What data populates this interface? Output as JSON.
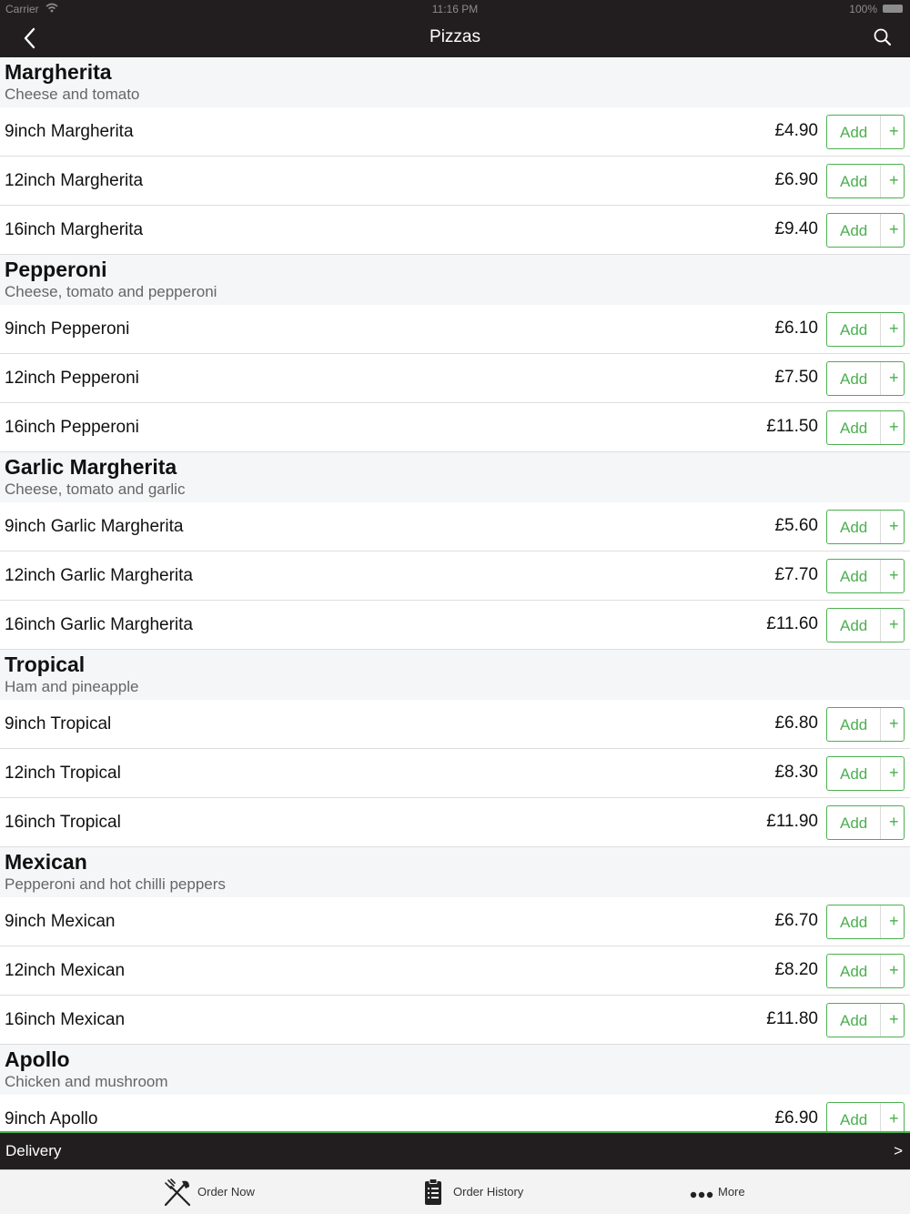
{
  "status_bar": {
    "carrier": "Carrier",
    "time": "11:16 PM",
    "battery": "100%"
  },
  "nav": {
    "title": "Pizzas"
  },
  "sections": [
    {
      "title": "Margherita",
      "description": "Cheese and tomato",
      "items": [
        {
          "name": "9inch Margherita",
          "price": "£4.90"
        },
        {
          "name": "12inch Margherita",
          "price": "£6.90"
        },
        {
          "name": "16inch Margherita",
          "price": "£9.40"
        }
      ]
    },
    {
      "title": "Pepperoni",
      "description": "Cheese, tomato and pepperoni",
      "items": [
        {
          "name": "9inch Pepperoni",
          "price": "£6.10"
        },
        {
          "name": "12inch Pepperoni",
          "price": "£7.50"
        },
        {
          "name": "16inch Pepperoni",
          "price": "£11.50"
        }
      ]
    },
    {
      "title": "Garlic Margherita",
      "description": "Cheese, tomato and garlic",
      "items": [
        {
          "name": "9inch Garlic Margherita",
          "price": "£5.60"
        },
        {
          "name": "12inch Garlic Margherita",
          "price": "£7.70"
        },
        {
          "name": "16inch Garlic Margherita",
          "price": "£11.60"
        }
      ]
    },
    {
      "title": "Tropical",
      "description": "Ham and pineapple",
      "items": [
        {
          "name": "9inch Tropical",
          "price": "£6.80"
        },
        {
          "name": "12inch Tropical",
          "price": "£8.30"
        },
        {
          "name": "16inch Tropical",
          "price": "£11.90"
        }
      ]
    },
    {
      "title": "Mexican",
      "description": "Pepperoni and hot chilli peppers",
      "items": [
        {
          "name": "9inch Mexican",
          "price": "£6.70"
        },
        {
          "name": "12inch Mexican",
          "price": "£8.20"
        },
        {
          "name": "16inch Mexican",
          "price": "£11.80"
        }
      ]
    },
    {
      "title": "Apollo",
      "description": "Chicken and mushroom",
      "items": [
        {
          "name": "9inch Apollo",
          "price": "£6.90"
        }
      ]
    }
  ],
  "add_button": {
    "label": "Add",
    "plus": "+"
  },
  "delivery_bar": {
    "label": "Delivery",
    "chevron": ">"
  },
  "tabs": [
    {
      "label": "Order Now",
      "icon": "fork-knife-icon"
    },
    {
      "label": "Order History",
      "icon": "clipboard-icon"
    },
    {
      "label": "More",
      "icon": "more-dots-icon"
    }
  ],
  "colors": {
    "accent": "#4caf50",
    "bar": "#221e1f",
    "section_bg": "#f5f6f7"
  }
}
